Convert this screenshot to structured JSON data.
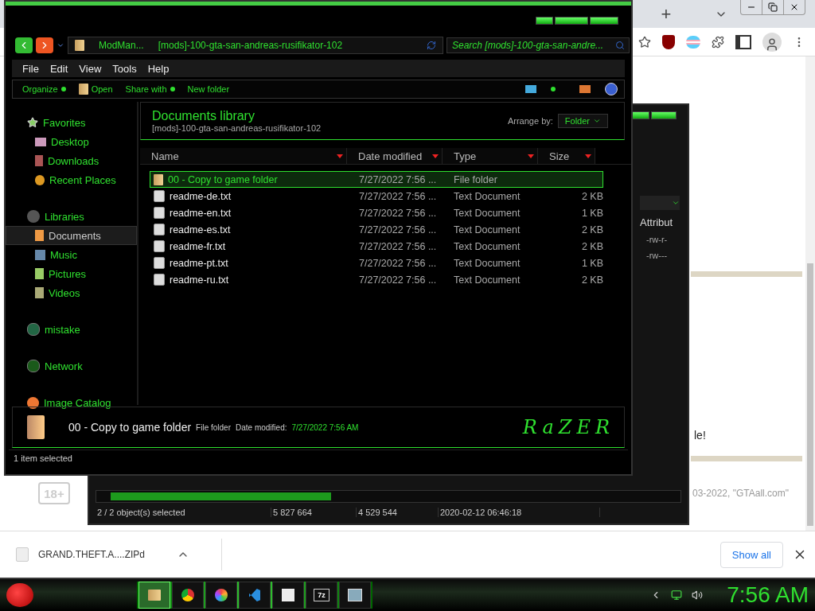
{
  "browser": {
    "new_tab": "+",
    "page": {
      "text_1": "le!",
      "badge": "18+",
      "footer": "03-2022, \"GTAall.com\""
    }
  },
  "download_bar": {
    "file": "GRAND.THEFT.A....ZIPd",
    "show_all": "Show all"
  },
  "back_window": {
    "column_header": "Attribut",
    "rows": [
      "-rw-r-",
      "-rw---"
    ],
    "status": [
      "2 / 2 object(s) selected",
      "5 827 664",
      "4 529 544",
      "2020-02-12 06:46:18"
    ]
  },
  "explorer": {
    "address": {
      "crumbs": [
        "ModMan...",
        "[mods]-100-gta-san-andreas-rusifikator-102"
      ]
    },
    "search": {
      "placeholder": "Search [mods]-100-gta-san-andre..."
    },
    "menu": [
      "File",
      "Edit",
      "View",
      "Tools",
      "Help"
    ],
    "commands": [
      {
        "label": "Organize",
        "kind": "dropdown"
      },
      {
        "label": "Open",
        "kind": "icon"
      },
      {
        "label": "Share with",
        "kind": "dropdown"
      },
      {
        "label": "New folder",
        "kind": "plain"
      }
    ],
    "sidebar": [
      {
        "label": "Favorites",
        "kind": "star",
        "selected": false,
        "children": [
          {
            "label": "Desktop",
            "kind": "desktop",
            "selected": false
          },
          {
            "label": "Downloads",
            "kind": "downloads",
            "selected": false
          },
          {
            "label": "Recent Places",
            "kind": "recent",
            "selected": false
          }
        ]
      },
      {
        "label": "Libraries",
        "kind": "libraries",
        "selected": false,
        "children": [
          {
            "label": "Documents",
            "kind": "documents",
            "selected": true
          },
          {
            "label": "Music",
            "kind": "music",
            "selected": false
          },
          {
            "label": "Pictures",
            "kind": "pictures",
            "selected": false
          },
          {
            "label": "Videos",
            "kind": "videos",
            "selected": false
          }
        ]
      },
      {
        "label": "mistake",
        "kind": "homegroup",
        "selected": false
      },
      {
        "label": "Network",
        "kind": "network",
        "selected": false
      },
      {
        "label": "Image Catalog",
        "kind": "catalog",
        "selected": false
      }
    ],
    "library": {
      "title": "Documents library",
      "path": "[mods]-100-gta-san-andreas-rusifikator-102",
      "arrange_label": "Arrange by:",
      "arrange_value": "Folder"
    },
    "columns": [
      "Name",
      "Date modified",
      "Type",
      "Size"
    ],
    "files": [
      {
        "name": "00 - Copy to game folder",
        "date": "7/27/2022 7:56 ...",
        "type": "File folder",
        "kind": "folder",
        "selected": true
      },
      {
        "name": "readme-de.txt",
        "date": "7/27/2022 7:56 ...",
        "type": "Text Document",
        "size": "2 KB",
        "kind": "text",
        "selected": false
      },
      {
        "name": "readme-en.txt",
        "date": "7/27/2022 7:56 ...",
        "type": "Text Document",
        "size": "1 KB",
        "kind": "text",
        "selected": false
      },
      {
        "name": "readme-es.txt",
        "date": "7/27/2022 7:56 ...",
        "type": "Text Document",
        "size": "2 KB",
        "kind": "text",
        "selected": false
      },
      {
        "name": "readme-fr.txt",
        "date": "7/27/2022 7:56 ...",
        "type": "Text Document",
        "size": "2 KB",
        "kind": "text",
        "selected": false
      },
      {
        "name": "readme-pt.txt",
        "date": "7/27/2022 7:56 ...",
        "type": "Text Document",
        "size": "1 KB",
        "kind": "text",
        "selected": false
      },
      {
        "name": "readme-ru.txt",
        "date": "7/27/2022 7:56 ...",
        "type": "Text Document",
        "size": "2 KB",
        "kind": "text",
        "selected": false
      }
    ],
    "details": {
      "name": "00 - Copy to game folder",
      "type": "File folder",
      "date_label": "Date modified:",
      "date": "7/27/2022 7:56 AM",
      "logo": "RaZER"
    },
    "status": "1 item selected"
  },
  "taskbar": {
    "apps": [
      {
        "kind": "folder",
        "active": true
      },
      {
        "kind": "chrome",
        "active": false
      },
      {
        "kind": "colorwheel",
        "active": false
      },
      {
        "kind": "code",
        "active": false
      },
      {
        "kind": "blank",
        "active": false
      },
      {
        "kind": "archiver",
        "label": "7z",
        "active": false
      },
      {
        "kind": "manager",
        "active": false
      }
    ],
    "clock": "7:56 AM"
  }
}
